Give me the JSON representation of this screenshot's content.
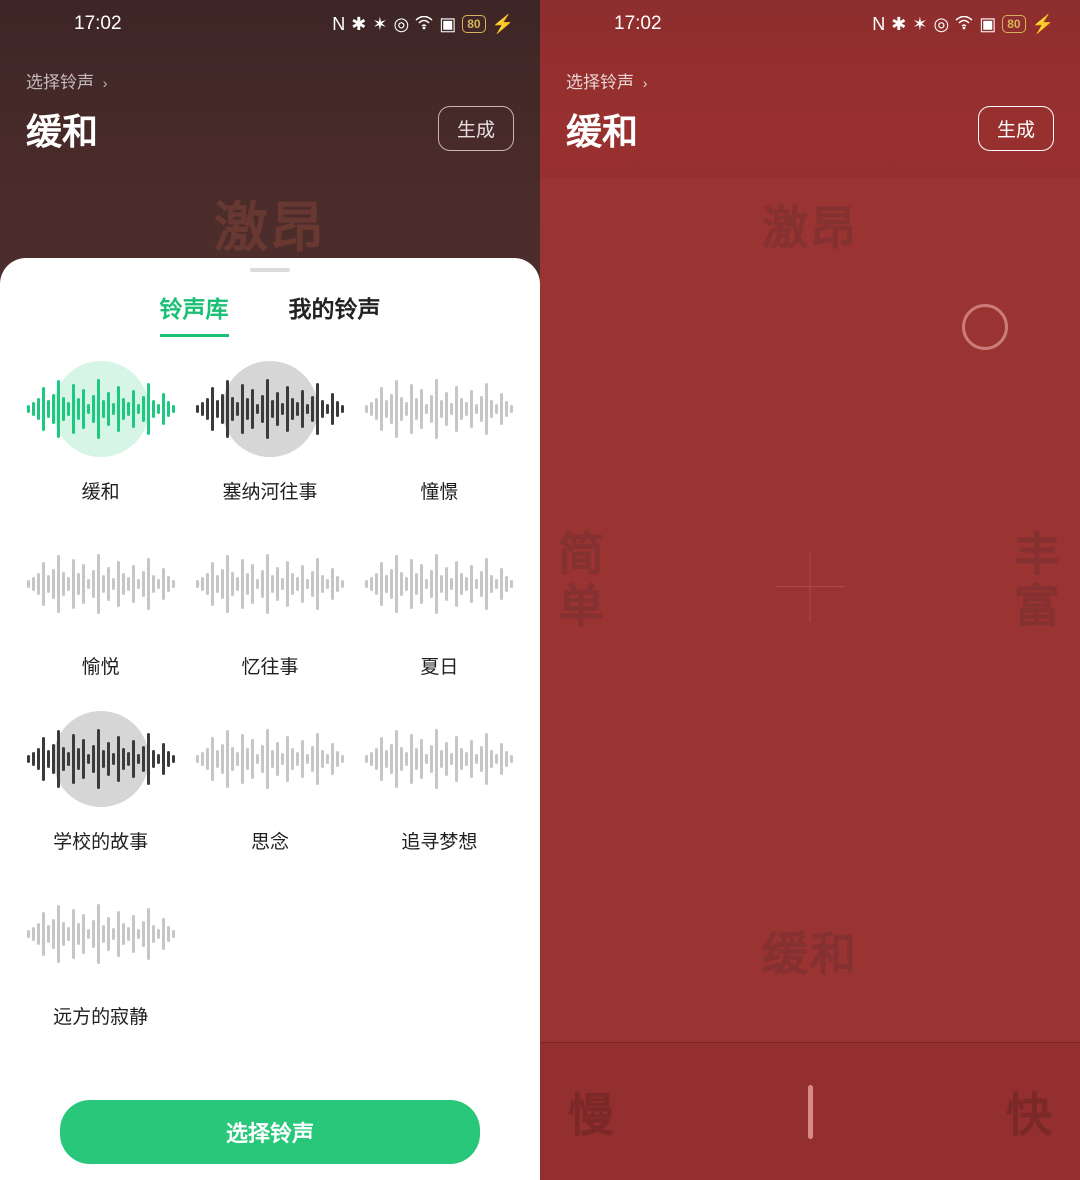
{
  "status": {
    "time": "17:02",
    "battery": "80"
  },
  "header": {
    "breadcrumb": "选择铃声",
    "title": "缓和",
    "generate_label": "生成"
  },
  "sheet": {
    "tabs": {
      "library": "铃声库",
      "mine": "我的铃声"
    },
    "items": [
      {
        "label": "缓和",
        "variant": "green"
      },
      {
        "label": "塞纳河往事",
        "variant": "dark"
      },
      {
        "label": "憧憬",
        "variant": "light"
      },
      {
        "label": "愉悦",
        "variant": "light"
      },
      {
        "label": "忆往事",
        "variant": "light"
      },
      {
        "label": "夏日",
        "variant": "light"
      },
      {
        "label": "学校的故事",
        "variant": "dark"
      },
      {
        "label": "思念",
        "variant": "light"
      },
      {
        "label": "追寻梦想",
        "variant": "light"
      },
      {
        "label": "远方的寂静",
        "variant": "light"
      }
    ],
    "select_button": "选择铃声"
  },
  "moodpad": {
    "top": "激昂",
    "bottom": "缓和",
    "left": "简单",
    "right": "丰富",
    "tempo_slow": "慢",
    "tempo_fast": "快"
  },
  "waveform_heights": [
    8,
    14,
    22,
    44,
    18,
    30,
    58,
    24,
    14,
    50,
    22,
    40,
    10,
    28,
    60,
    18,
    34,
    12,
    46,
    22,
    14,
    38,
    10,
    26,
    52,
    18,
    10,
    32,
    16,
    8
  ]
}
